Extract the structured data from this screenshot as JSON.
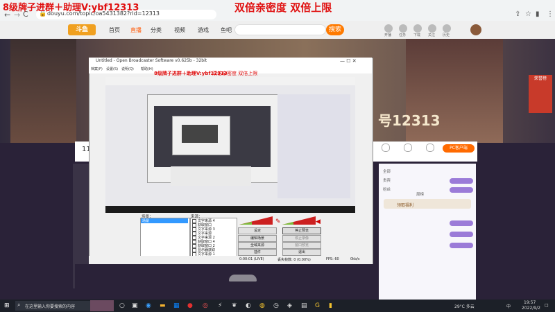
{
  "browser": {
    "url": "douyu.com/topic/oa5431382?rid=12313",
    "back": "←",
    "forward": "→",
    "reload": "C"
  },
  "overlay": {
    "left": "8级牌子进群＋助理V:ybf12313",
    "right": "双倍亲密度  双倍上限"
  },
  "site": {
    "nav": [
      "首页",
      "直播",
      "分类",
      "视频",
      "游戏",
      "鱼吧"
    ],
    "search_btn": "搜索",
    "icons": [
      "开播",
      "任务",
      "下载",
      "关注",
      "历史"
    ],
    "banner_room": "号12313",
    "badge": "荣誉榜",
    "info_num": "11",
    "orange_badge": "PC客户端"
  },
  "right_panel": {
    "rows": [
      "全部",
      "贵宾",
      "粉丝",
      "周榜"
    ],
    "button": "领取福利"
  },
  "obs": {
    "title": "Untitled - Open Broadcaster Software v0.625b - 32bit",
    "window_controls": "—   ☐   ✕",
    "menus": [
      "档案(F)",
      "设置(S)",
      "说明(Q)",
      "帮助(H)"
    ],
    "overlay_left": "8级牌子进群＋助理V:ybf12313",
    "overlay_right": "双倍亲密度  双倍上限",
    "scenes_label": "场景：",
    "sources_label": "来源：",
    "scene_selected": "场景",
    "sources": [
      "文字来源 4",
      "获取窗口",
      "文字来源 3",
      "文字来源",
      "文字来源 2",
      "获取窗口 4",
      "获取窗口 2",
      "显示器获取",
      "文字来源 1"
    ],
    "buttons": {
      "settings": "设定",
      "stop_preview": "停止预览",
      "edit_scene": "编辑场景",
      "stop_record": "停止录像",
      "fullscreen": "全域来源",
      "global_sources": "窗口预览",
      "plugins": "插件",
      "exit": "退出"
    },
    "status": {
      "time": "0:00:01 (LIVE)",
      "dropped": "丢失帧数: 0 (0.00%)",
      "fps": "FPS: 60",
      "bitrate": "0kb/s"
    }
  },
  "taskbar": {
    "start": "⊞",
    "search_text": "在这里输入你要搜索的内容",
    "search_icon": "search-icon",
    "weather": "29°C 多云",
    "ime": "中",
    "time": "19:57",
    "date": "2022/9/2"
  },
  "colors": {
    "overlay_red": "#e01010",
    "accent_orange": "#ff6a00",
    "obs_selection": "#3399ff"
  }
}
